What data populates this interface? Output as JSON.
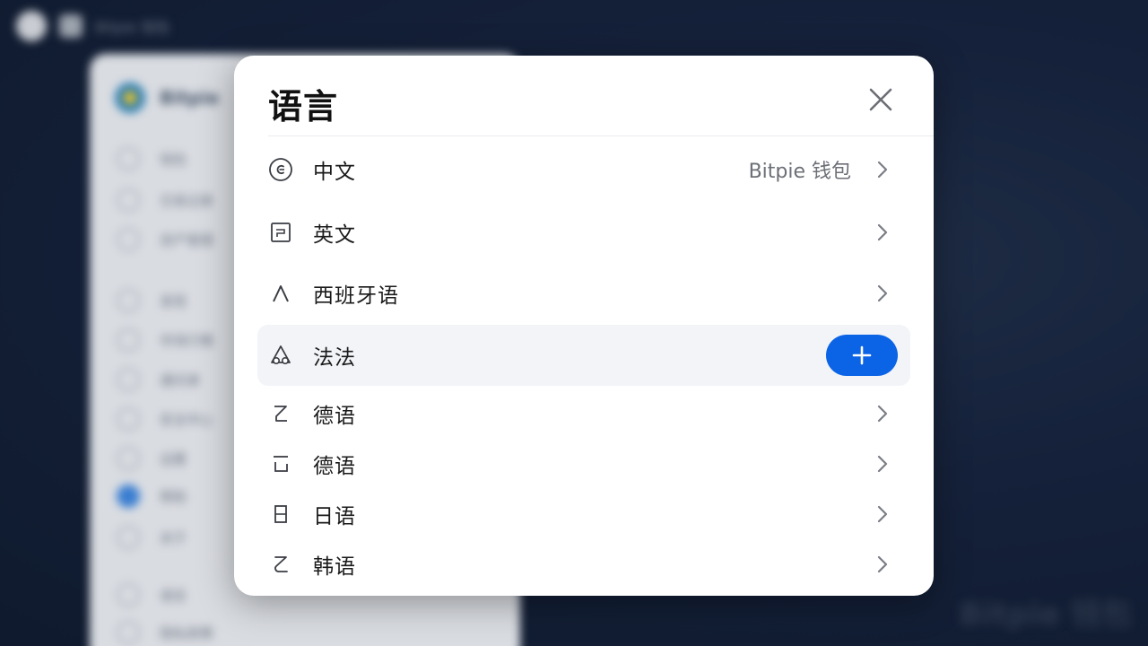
{
  "background": {
    "topbar_text": "Bitpie 钱包",
    "brand_name": "Bitpie",
    "sidebar_items": [
      "钱包",
      "交易记录",
      "资产管理",
      "发现",
      "市场行情",
      "通讯录",
      "安全中心",
      "设置",
      "帮助",
      "关于",
      "语言",
      "隐私政策"
    ]
  },
  "modal": {
    "title": "语言",
    "close_icon": "close-icon",
    "rows": [
      {
        "label": "中文",
        "value": "Bitpie 钱包",
        "icon": "chat-circle-icon",
        "action": "chevron"
      },
      {
        "label": "英文",
        "value": "",
        "icon": "message-square-icon",
        "action": "chevron"
      },
      {
        "label": "西班牙语",
        "value": "",
        "icon": "caret-up-icon",
        "action": "chevron"
      },
      {
        "label": "法法",
        "value": "",
        "icon": "triangle-circles-icon",
        "action": "add",
        "highlighted": true
      },
      {
        "label": "德语",
        "value": "",
        "icon": "z-shape-icon",
        "action": "chevron"
      },
      {
        "label": "德语",
        "value": "",
        "icon": "bracket-shape-icon",
        "action": "chevron"
      },
      {
        "label": "日语",
        "value": "",
        "icon": "sun-glyph-icon",
        "action": "chevron"
      },
      {
        "label": "韩语",
        "value": "",
        "icon": "z-curve-icon",
        "action": "chevron"
      }
    ]
  },
  "colors": {
    "accent": "#0b63e5",
    "backdrop": "#15213a",
    "modal_bg": "#ffffff",
    "highlight_row": "#f2f4f8"
  }
}
